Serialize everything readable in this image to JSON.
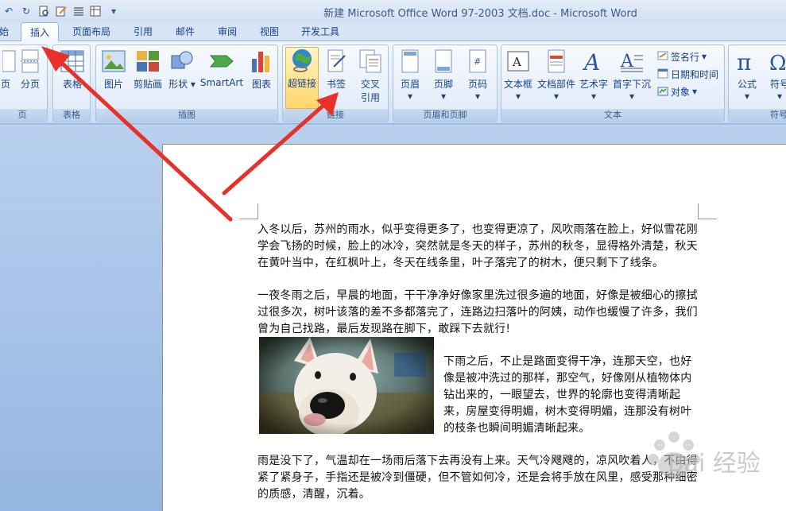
{
  "window": {
    "title": "新建 Microsoft Office Word 97-2003 文档.doc - Microsoft Word"
  },
  "tabs": [
    "始",
    "插入",
    "页面布局",
    "引用",
    "邮件",
    "审阅",
    "视图",
    "开发工具"
  ],
  "active_tab": "插入",
  "ribbon": {
    "groups": {
      "pages": "页",
      "table": "表格",
      "illustrations": "插图",
      "links": "链接",
      "header_footer": "页眉和页脚",
      "text": "文本",
      "symbols": "符号"
    },
    "buttons": {
      "page": "页",
      "page_break": "分页",
      "table": "表格",
      "picture": "图片",
      "clipart": "剪贴画",
      "shapes": "形状",
      "smartart": "SmartArt",
      "chart": "图表",
      "hyperlink": "超链接",
      "bookmark": "书签",
      "cross_ref_1": "交叉",
      "cross_ref_2": "引用",
      "header": "页眉",
      "footer": "页脚",
      "page_number": "页码",
      "textbox": "文本框",
      "quick_parts": "文档部件",
      "wordart": "艺术字",
      "dropcap": "首字下沉",
      "signature": "签名行",
      "datetime": "日期和时间",
      "object": "对象",
      "equation": "公式",
      "symbol": "符号"
    }
  },
  "document": {
    "p1": "入冬以后，苏州的雨水，似乎变得更多了，也变得更凉了，风吹雨落在脸上，好似雪花刚学会飞扬的时候，脸上的冰冷，突然就是冬天的样子，苏州的秋冬，显得格外清楚，秋天在黄叶当中，在红枫叶上，冬天在线条里，叶子落完了的树木，便只剩下了线条。",
    "p2": "一夜冬雨之后，早晨的地面，干干净净好像家里洗过很多遍的地面，好像是被细心的擦拭过很多次，树叶该落的差不多都落完了，连路边扫落叶的阿姨，动作也缓慢了许多，我们曾为自己找路，最后发现路在脚下，敢踩下去就行!",
    "p3": "下雨之后，不止是路面变得干净，连那天空，也好像是被冲洗过的那样，那空气，好像刚从植物体内钻出来的，一眼望去，世界的轮廓也变得清晰起来，房屋变得明媚，树木变得明媚，连那没有树叶的枝条也瞬间明媚清晰起来。",
    "p4": "雨是没下了，气温却在一场雨后落下去再没有上来。天气冷飕飕的，凉风吹着人，不由得紧了紧身子，手指还是被冷到僵硬，但不管如何冷，还是会将手放在风里，感受那种细密的质感，清醒，沉着。"
  },
  "watermark": "Bai 经验",
  "colors": {
    "accent": "#15428b",
    "arrow": "#e8312a",
    "highlight": "#ffd56a"
  }
}
